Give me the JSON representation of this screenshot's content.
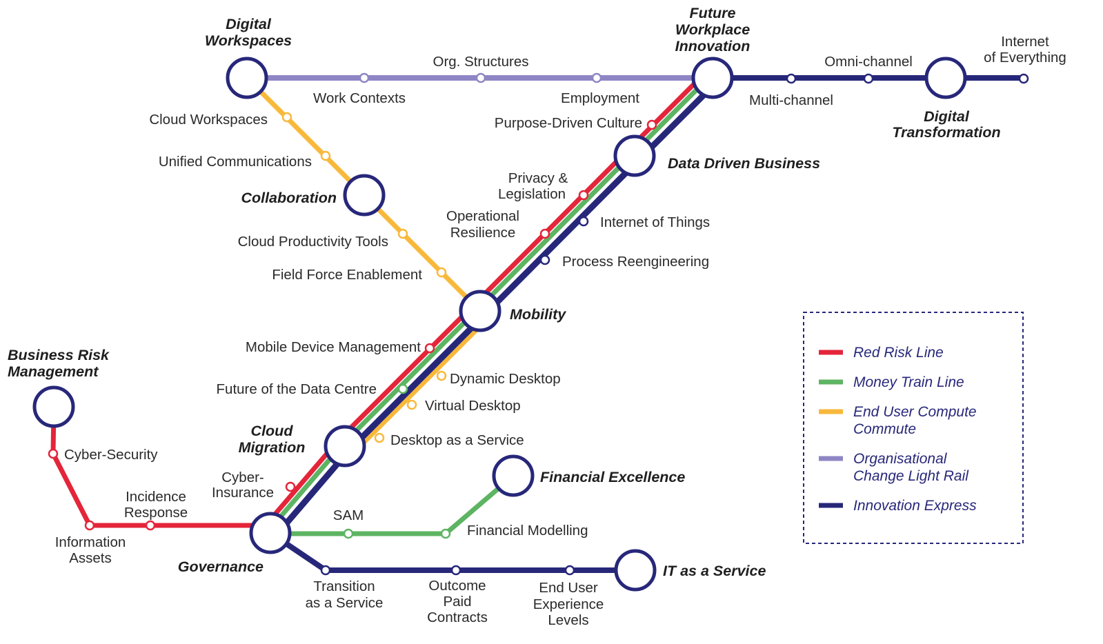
{
  "colors": {
    "red": "#e4253a",
    "green": "#5db462",
    "yellow": "#f8b93b",
    "lavender": "#8e86c4",
    "navy": "#27277a"
  },
  "stations": {
    "digital_workspaces": [
      "Digital",
      "Workspaces"
    ],
    "future_workplace": [
      "Future",
      "Workplace",
      "Innovation"
    ],
    "digital_transformation": [
      "Digital",
      "Transformation"
    ],
    "data_driven": "Data Driven Business",
    "collaboration": "Collaboration",
    "mobility": "Mobility",
    "cloud_migration": [
      "Cloud",
      "Migration"
    ],
    "financial_excellence": "Financial Excellence",
    "governance": "Governance",
    "it_as_service": "IT as a Service",
    "business_risk": [
      "Business Risk",
      "Management"
    ]
  },
  "stops": {
    "org_structures": "Org. Structures",
    "work_contexts": "Work Contexts",
    "employment": "Employment",
    "omni_channel": "Omni-channel",
    "multi_channel": "Multi-channel",
    "internet_everything": [
      "Internet",
      "of Everything"
    ],
    "cloud_workspaces": "Cloud Workspaces",
    "unified_comms": "Unified Communications",
    "purpose_driven": "Purpose-Driven Culture",
    "privacy": [
      "Privacy &",
      "Legislation"
    ],
    "operational": [
      "Operational",
      "Resilience"
    ],
    "iot": "Internet of Things",
    "process": "Process Reengineering",
    "cloud_productivity": "Cloud Productivity Tools",
    "field_force": "Field Force Enablement",
    "mdm": "Mobile Device Management",
    "dynamic_desktop": "Dynamic Desktop",
    "data_centre": "Future of the Data Centre",
    "virtual_desktop": "Virtual Desktop",
    "daas": "Desktop as a Service",
    "cyber_security": "Cyber-Security",
    "cyber_insurance": [
      "Cyber-",
      "Insurance"
    ],
    "incidence": [
      "Incidence",
      "Response"
    ],
    "sam": "SAM",
    "financial_modelling": "Financial Modelling",
    "info_assets": [
      "Information",
      "Assets"
    ],
    "transition": [
      "Transition",
      "as a Service"
    ],
    "outcome": [
      "Outcome",
      "Paid",
      "Contracts"
    ],
    "end_user": [
      "End User",
      "Experience",
      "Levels"
    ]
  },
  "legend": [
    {
      "label": [
        "Red Risk Line"
      ],
      "color": "#e4253a"
    },
    {
      "label": [
        "Money Train Line"
      ],
      "color": "#5db462"
    },
    {
      "label": [
        "End User Compute",
        "Commute"
      ],
      "color": "#f8b93b"
    },
    {
      "label": [
        "Organisational",
        "Change Light Rail"
      ],
      "color": "#8e86c4"
    },
    {
      "label": [
        "Innovation Express"
      ],
      "color": "#27277a"
    }
  ]
}
